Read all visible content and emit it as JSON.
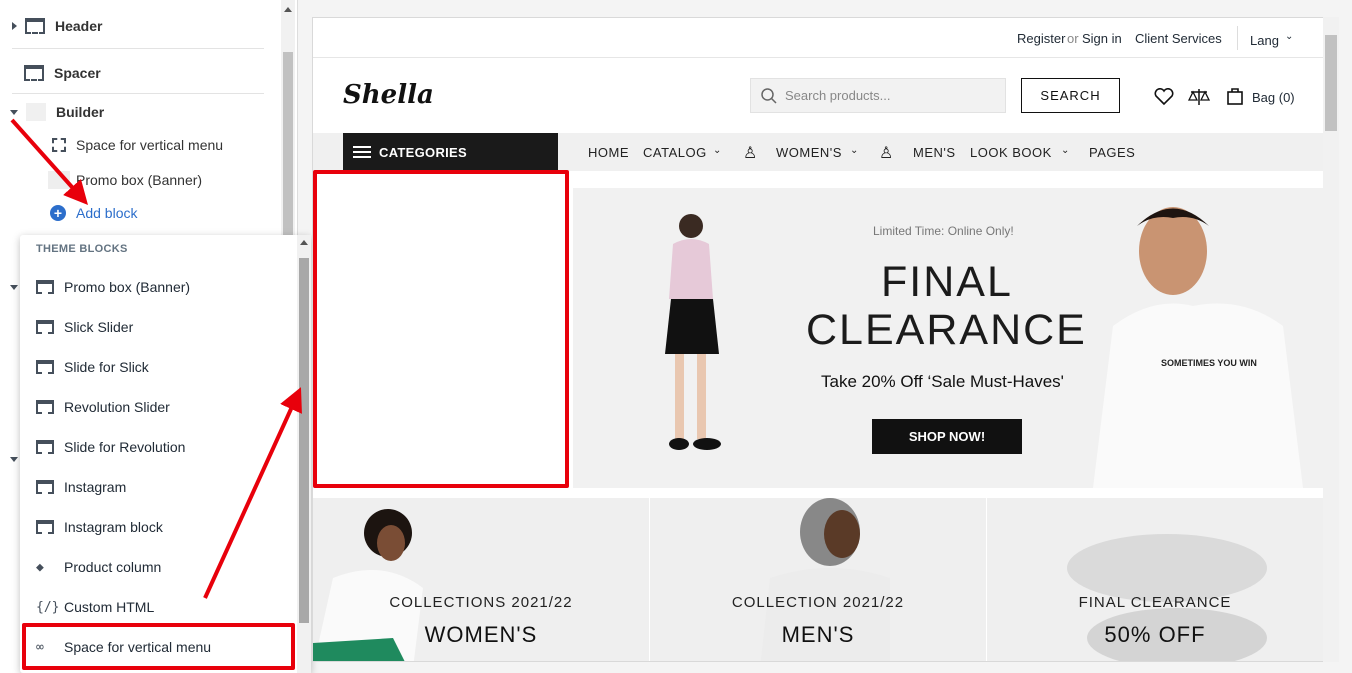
{
  "editor": {
    "tree": {
      "header": "Header",
      "spacer": "Spacer",
      "builder": "Builder",
      "space_vertical_menu": "Space for vertical menu",
      "promo_box": "Promo box (Banner)",
      "add_block": "Add block"
    },
    "popup": {
      "heading": "THEME BLOCKS",
      "items": [
        {
          "label": "Promo box (Banner)",
          "icon": "section-icon"
        },
        {
          "label": "Slick Slider",
          "icon": "section-icon"
        },
        {
          "label": "Slide for Slick",
          "icon": "section-icon"
        },
        {
          "label": "Revolution Slider",
          "icon": "section-icon"
        },
        {
          "label": "Slide for Revolution",
          "icon": "section-icon"
        },
        {
          "label": "Instagram",
          "icon": "section-icon"
        },
        {
          "label": "Instagram block",
          "icon": "section-icon"
        },
        {
          "label": "Product column",
          "icon": "tag-icon"
        },
        {
          "label": "Custom HTML",
          "icon": "code-icon"
        },
        {
          "label": "Space for vertical menu",
          "icon": "link-icon"
        }
      ]
    }
  },
  "store": {
    "topbar": {
      "register": "Register",
      "or": "or",
      "signin": "Sign in",
      "client": "Client Services",
      "lang": "Lang"
    },
    "logo": "Shella",
    "search_placeholder": "Search products...",
    "search_button": "SEARCH",
    "bag": "Bag (0)",
    "nav": {
      "categories": "CATEGORIES",
      "items": [
        "HOME",
        "CATALOG",
        "WOMEN'S",
        "MEN'S",
        "LOOK BOOK",
        "PAGES"
      ]
    },
    "banner": {
      "pretitle": "Limited Time: Online Only!",
      "title1": "FINAL",
      "title2": "CLEARANCE",
      "subtitle": "Take 20% Off ‘Sale Must-Haves'",
      "button": "SHOP NOW!",
      "tshirt_text": "SOMETIMES YOU WIN"
    },
    "tiles": [
      {
        "top": "COLLECTIONS 2021/22",
        "bottom": "WOMEN'S"
      },
      {
        "top": "COLLECTION 2021/22",
        "bottom": "MEN'S"
      },
      {
        "top": "FINAL CLEARANCE",
        "bottom": "50% OFF"
      }
    ]
  },
  "colors": {
    "annotation": "#e8000b",
    "link": "#2c6ecb",
    "dark": "#1a1a1a"
  }
}
